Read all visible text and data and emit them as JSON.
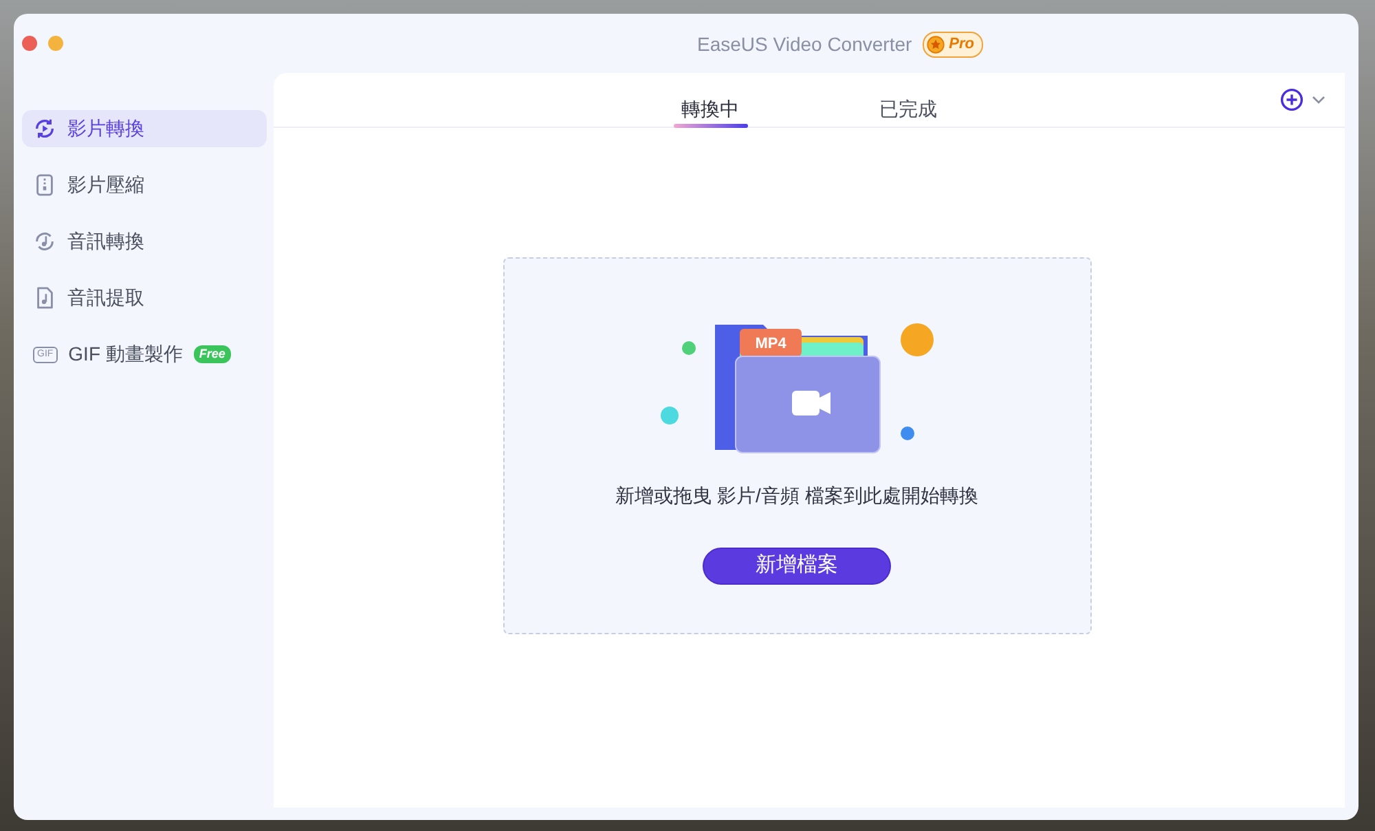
{
  "window": {
    "title": "EaseUS Video Converter",
    "badge": "Pro"
  },
  "sidebar": {
    "items": [
      {
        "label": "影片轉換",
        "selected": true,
        "kind": "convert"
      },
      {
        "label": "影片壓縮",
        "selected": false,
        "kind": "compress"
      },
      {
        "label": "音訊轉換",
        "selected": false,
        "kind": "audio"
      },
      {
        "label": "音訊提取",
        "selected": false,
        "kind": "extract"
      },
      {
        "label": "GIF 動畫製作",
        "selected": false,
        "kind": "gif",
        "icon_text": "GIF",
        "badge": "Free"
      }
    ]
  },
  "tabs": [
    {
      "label": "轉換中",
      "selected": true
    },
    {
      "label": "已完成",
      "selected": false
    }
  ],
  "dropzone": {
    "file_tag": "MP4",
    "message": "新增或拖曳 影片/音頻 檔案到此處開始轉換",
    "button": "新增檔案"
  }
}
